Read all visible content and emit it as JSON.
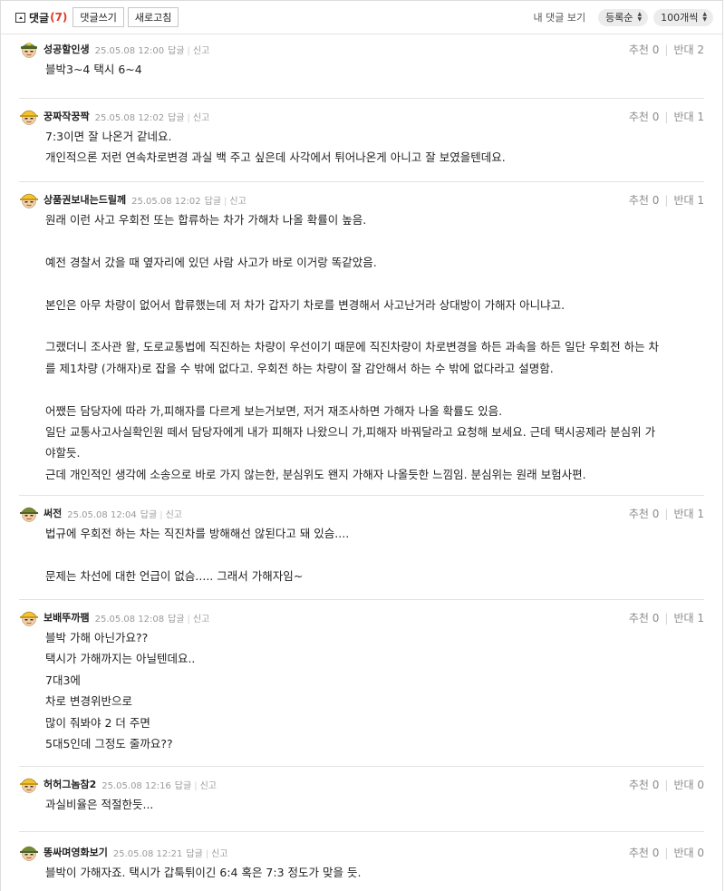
{
  "toolbar": {
    "title": "댓글",
    "count": "(7)",
    "write_label": "댓글쓰기",
    "refresh_label": "새로고침",
    "my_comments_label": "내 댓글 보기",
    "sort_label": "등록순",
    "page_size_label": "100개씩"
  },
  "comments": [
    {
      "nick": "성공할인생",
      "date": "25.05.08 12:00",
      "reply": "답글",
      "report": "신고",
      "up": "추천 0",
      "down": "반대 2",
      "avatar": "soldier-avatar-green-cap",
      "lines": [
        "블박3~4 택시 6~4"
      ]
    },
    {
      "nick": "꿍짜작꿍짝",
      "date": "25.05.08 12:02",
      "reply": "답글",
      "report": "신고",
      "up": "추천 0",
      "down": "반대 1",
      "avatar": "soldier-avatar-yellow-helmet",
      "lines": [
        "7:3이면 잘 나온거 같네요.",
        "개인적으론 저런 연속차로변경 과실 백 주고 싶은데 사각에서 튀어나온게 아니고 잘 보였을텐데요."
      ]
    },
    {
      "nick": "상품권보내는드릴께",
      "date": "25.05.08 12:02",
      "reply": "답글",
      "report": "신고",
      "up": "추천 0",
      "down": "반대 1",
      "avatar": "soldier-avatar-yellow-helmet",
      "lines": [
        "원래 이런 사고 우회전 또는 합류하는 차가 가해차 나올 확률이 높음.",
        "",
        "예전 경찰서 갔을 때 옆자리에 있던 사람 사고가 바로 이거랑 똑같았음.",
        "",
        "본인은 아무 차량이 없어서 합류했는데 저 차가 갑자기 차로를 변경해서 사고난거라 상대방이 가해자 아니냐고.",
        "",
        "그랬더니 조사관 왈, 도로교통법에 직진하는 차량이 우선이기 때문에 직진차량이 차로변경을 하든 과속을 하든 일단 우회전 하는 차",
        "를 제1차량 (가해자)로 잡을 수 밖에 없다고. 우회전 하는 차량이 잘 감안해서 하는 수 밖에 없다라고 설명함.",
        "",
        "어쨌든 담당자에 따라 가,피해자를 다르게 보는거보면, 저거 재조사하면 가해자 나올 확률도 있음.",
        "일단 교통사고사실확인원 떼서 담당자에게 내가 피해자 나왔으니 가,피해자 바꿔달라고 요청해 보세요. 근데 택시공제라 분심위 가",
        "야할듯.",
        "근데 개인적인 생각에 소송으로 바로 가지 않는한, 분심위도 왠지 가해자 나올듯한 느낌임. 분심위는 원래 보험사편."
      ]
    },
    {
      "nick": "써전",
      "date": "25.05.08 12:04",
      "reply": "답글",
      "report": "신고",
      "up": "추천 0",
      "down": "반대 1",
      "avatar": "soldier-avatar-green-helmet",
      "lines": [
        "법규에 우회전 하는 차는 직진차를 방해해선 않된다고 돼 있슴....",
        "",
        "문제는 차선에 대한 언급이 없슴..... 그래서 가해자임~"
      ]
    },
    {
      "nick": "보배뚜까팸",
      "date": "25.05.08 12:08",
      "reply": "답글",
      "report": "신고",
      "up": "추천 0",
      "down": "반대 1",
      "avatar": "soldier-avatar-yellow-helmet",
      "lines": [
        "블박 가해 아닌가요??",
        "택시가 가해까지는 아닐텐데요..",
        "7대3에",
        "차로 변경위반으로",
        "많이 줘봐야 2 더 주면",
        "5대5인데 그정도 줄까요??"
      ]
    },
    {
      "nick": "허허그놈참2",
      "date": "25.05.08 12:16",
      "reply": "답글",
      "report": "신고",
      "up": "추천 0",
      "down": "반대 0",
      "avatar": "soldier-avatar-yellow-helmet",
      "lines": [
        "과실비율은 적절한듯..."
      ]
    },
    {
      "nick": "똥싸며영화보기",
      "date": "25.05.08 12:21",
      "reply": "답글",
      "report": "신고",
      "up": "추천 0",
      "down": "반대 0",
      "avatar": "soldier-avatar-green-helmet",
      "lines": [
        "블박이 가해자죠. 택시가 갑툭튀이긴 6:4 혹은 7:3 정도가 맞을 듯."
      ]
    }
  ],
  "colors": {
    "count_red": "#e03b24",
    "helmet_yellow": "#f2c230",
    "helmet_green": "#6f8a3a",
    "skin": "#f5cfa3"
  }
}
